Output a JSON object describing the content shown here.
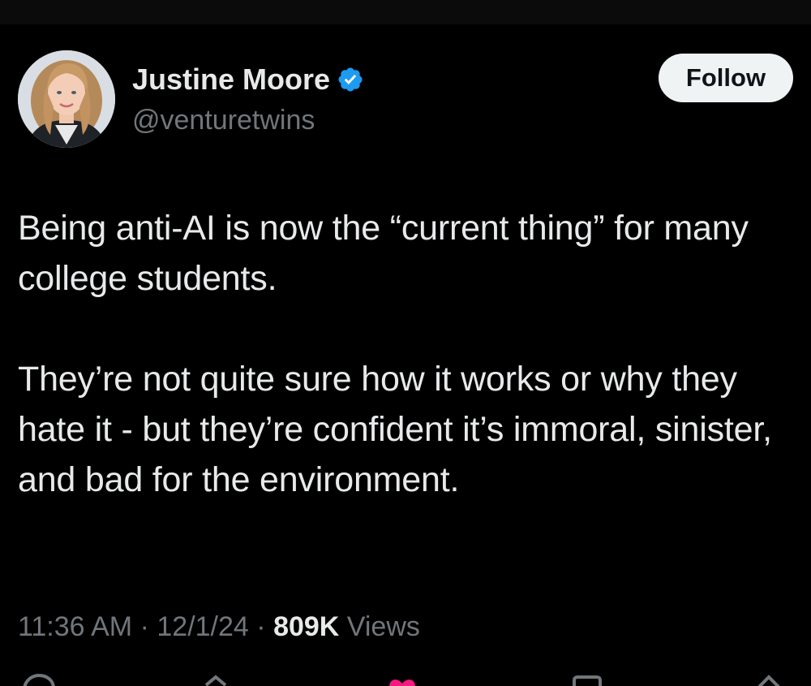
{
  "author": {
    "display_name": "Justine Moore",
    "handle": "@venturetwins",
    "verified_icon": "verified-badge-icon"
  },
  "follow_label": "Follow",
  "tweet": {
    "paragraphs": [
      "Being anti-AI is now the “current thing” for many college students.",
      "They’re not quite sure how it works or why they hate it - but they’re confident it’s immoral, sinister, and bad for the environment."
    ]
  },
  "meta": {
    "time": "11:36 AM",
    "date": "12/1/24",
    "separator": "·",
    "views_count": "809K",
    "views_label": "Views"
  },
  "actions": [
    "reply-icon",
    "repost-icon",
    "like-icon",
    "bookmark-icon",
    "share-icon"
  ],
  "colors": {
    "background": "#000000",
    "text_primary": "#e7e9ea",
    "text_secondary": "#71767b",
    "verified_blue": "#1d9bf0",
    "follow_bg": "#eff3f4",
    "like_pink": "#f91880"
  }
}
